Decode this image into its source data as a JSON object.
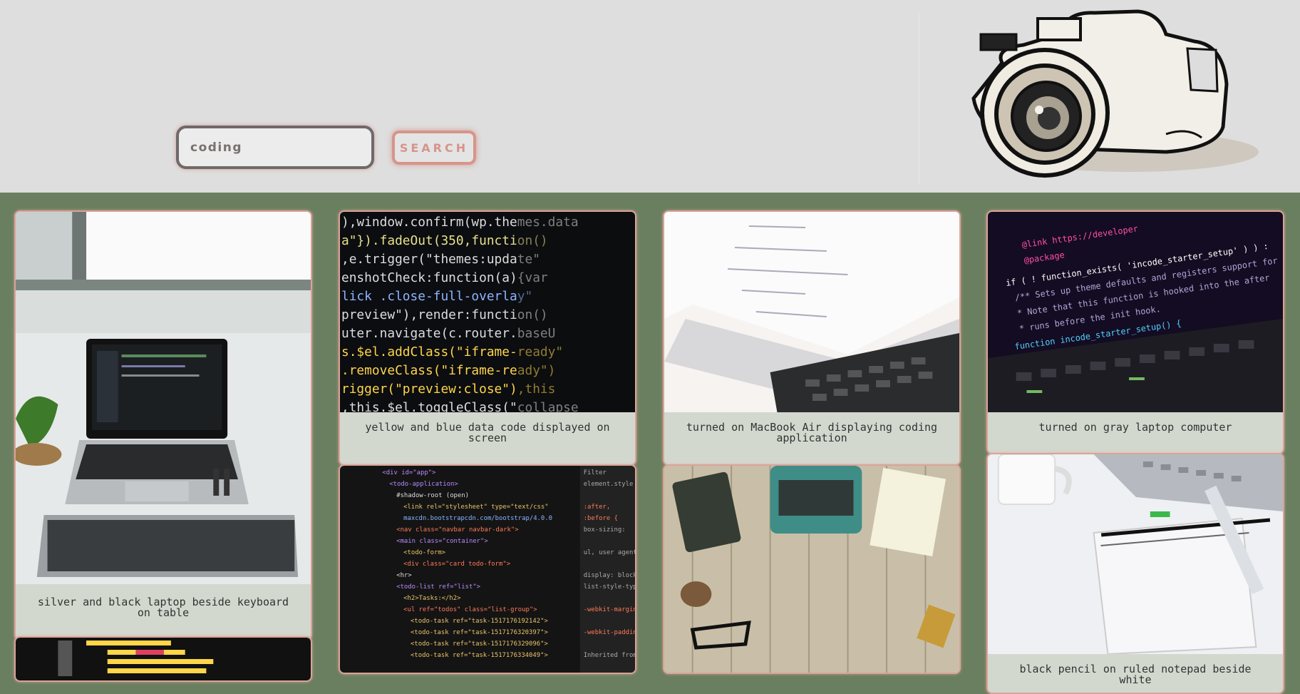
{
  "search": {
    "value": "coding",
    "button_label": "SEARCH"
  },
  "logo": {
    "icon": "camera-sketch-icon"
  },
  "colors": {
    "header_bg": "#dedede",
    "page_bg": "#6a7f5f",
    "accent": "#d6958b",
    "card_bg": "#d3d8cf"
  },
  "gallery": [
    {
      "caption": "silver and black laptop beside keyboard on table"
    },
    {
      "caption": "yellow and blue data code displayed on screen"
    },
    {
      "caption": "turned on MacBook Air displaying coding application"
    },
    {
      "caption": "turned on gray laptop computer"
    },
    {
      "caption": ""
    },
    {
      "caption": ""
    },
    {
      "caption": ""
    },
    {
      "caption": "black pencil on ruled notepad beside white"
    }
  ]
}
